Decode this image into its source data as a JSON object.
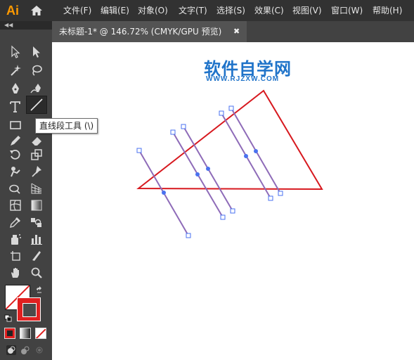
{
  "app": {
    "logo_text": "Ai"
  },
  "menu": {
    "items": [
      "文件(F)",
      "编辑(E)",
      "对象(O)",
      "文字(T)",
      "选择(S)",
      "效果(C)",
      "视图(V)",
      "窗口(W)",
      "帮助(H)"
    ]
  },
  "document": {
    "tab_title": "未标题-1* @ 146.72% (CMYK/GPU 预览)",
    "close_glyph": "✖"
  },
  "tooltip": {
    "text": "直线段工具 (\\)"
  },
  "watermark": {
    "title": "软件自学网",
    "url": "WWW.RJZXW.COM"
  },
  "colors": {
    "triangle_stroke": "#D7191F",
    "line_stroke": "#8E6BB8",
    "anchor_color": "#4A72F0",
    "watermark": "#1F73C9",
    "stroke_swatch": "#E02020"
  },
  "toolbar": {
    "tools": [
      "selection-tool",
      "direct-selection-tool",
      "magic-wand-tool",
      "lasso-tool",
      "pen-tool",
      "curvature-tool",
      "type-tool",
      "line-segment-tool",
      "rectangle-tool",
      "paintbrush-tool",
      "pencil-tool",
      "eraser-tool",
      "rotate-tool",
      "scale-tool",
      "puppet-warp-tool",
      "pin-tool",
      "shape-builder-tool",
      "perspective-grid-tool",
      "mesh-tool",
      "gradient-tool",
      "eyedropper-tool",
      "blend-tool",
      "symbol-sprayer-tool",
      "column-graph-tool",
      "artboard-tool",
      "slice-tool",
      "hand-tool",
      "zoom-tool"
    ],
    "active_tool": "line-segment-tool"
  }
}
